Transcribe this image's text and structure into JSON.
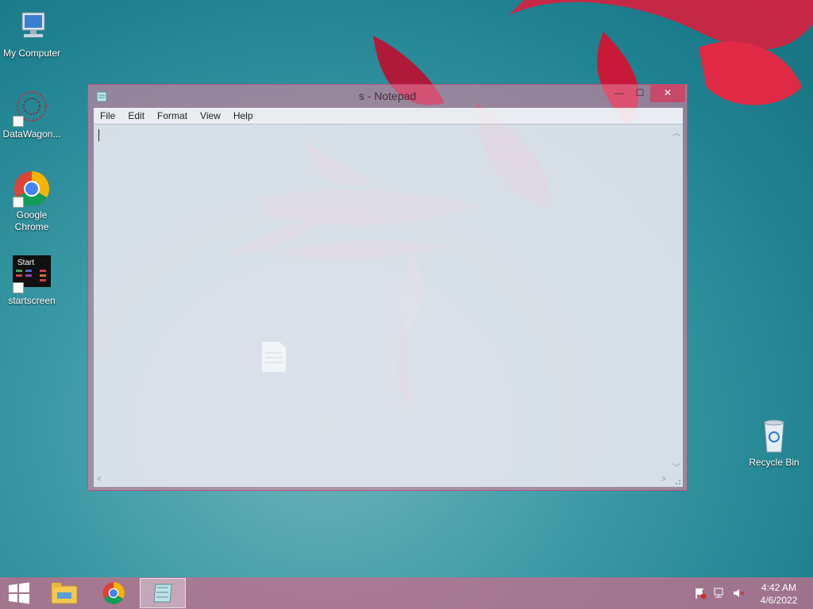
{
  "desktop": {
    "icons": [
      {
        "label": "My Computer",
        "icon": "computer-icon"
      },
      {
        "label": "DataWagon...",
        "icon": "datawagon-icon"
      },
      {
        "label": "Google Chrome",
        "icon": "chrome-icon"
      },
      {
        "label": "startscreen",
        "icon": "startscreen-icon"
      },
      {
        "label": "Recycle Bin",
        "icon": "recycle-bin-icon"
      }
    ],
    "startscreen_badge": "Start"
  },
  "window": {
    "title": "s - Notepad",
    "controls": {
      "minimize": "—",
      "maximize": "☐",
      "close": "✕"
    },
    "menu": [
      "File",
      "Edit",
      "Format",
      "View",
      "Help"
    ],
    "content": ""
  },
  "taskbar": {
    "items": [
      {
        "name": "start-button",
        "icon": "windows-logo-icon"
      },
      {
        "name": "file-explorer",
        "icon": "folder-icon"
      },
      {
        "name": "google-chrome",
        "icon": "chrome-icon"
      },
      {
        "name": "notepad",
        "icon": "notepad-icon",
        "active": true
      }
    ],
    "tray": [
      "flag-icon",
      "network-icon",
      "volume-muted-icon"
    ],
    "time": "4:42 AM",
    "date": "4/6/2022"
  },
  "colors": {
    "accent": "#d2557e",
    "wallpaper": "#1f8190"
  }
}
